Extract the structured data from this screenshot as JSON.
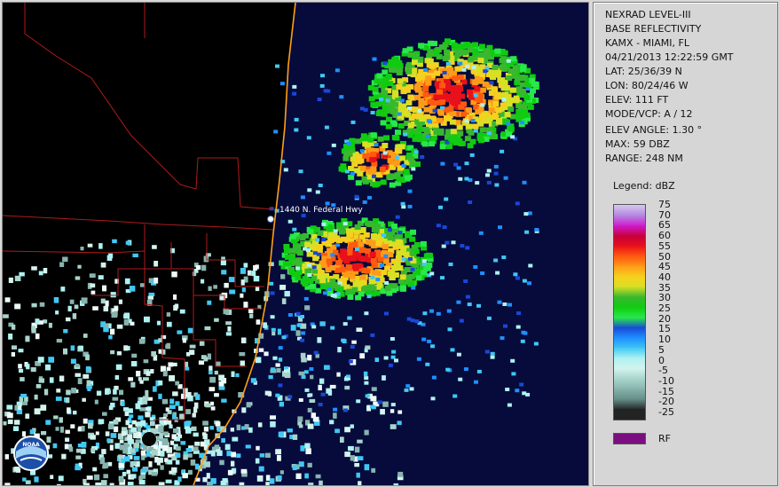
{
  "panel": {
    "product_lines": [
      "NEXRAD LEVEL-III",
      "BASE REFLECTIVITY",
      "KAMX - MIAMI, FL",
      "04/21/2013 12:22:59 GMT",
      "LAT: 25/36/39 N",
      "LON: 80/24/46 W",
      "ELEV: 111 FT",
      "MODE/VCP: A / 12"
    ],
    "scan_lines": [
      "ELEV ANGLE: 1.30 °",
      "MAX: 59 DBZ",
      "RANGE: 248 NM"
    ],
    "legend_title": "Legend: dBZ",
    "legend_levels": [
      {
        "label": "75",
        "color": "#d6c8f0"
      },
      {
        "label": "70",
        "color": "#b486e0"
      },
      {
        "label": "65",
        "color": "#d01ad0"
      },
      {
        "label": "60",
        "color": "#c8003c"
      },
      {
        "label": "55",
        "color": "#e8101a"
      },
      {
        "label": "50",
        "color": "#ff5a10"
      },
      {
        "label": "45",
        "color": "#ff9b18"
      },
      {
        "label": "40",
        "color": "#f6d01e"
      },
      {
        "label": "35",
        "color": "#d8e024"
      },
      {
        "label": "30",
        "color": "#38b82e"
      },
      {
        "label": "25",
        "color": "#10cc10"
      },
      {
        "label": "20",
        "color": "#28e84a"
      },
      {
        "label": "15",
        "color": "#1848d8"
      },
      {
        "label": "10",
        "color": "#1e90ff"
      },
      {
        "label": "5",
        "color": "#40c8f4"
      },
      {
        "label": "0",
        "color": "#aef2f2"
      },
      {
        "label": "-5",
        "color": "#d4f4ee"
      },
      {
        "label": "-10",
        "color": "#a8d4cc"
      },
      {
        "label": "-15",
        "color": "#88b4ae"
      },
      {
        "label": "-20",
        "color": "#668e88"
      },
      {
        "label": "-25",
        "color": "#222424"
      }
    ],
    "rf_label": "RF",
    "rf_color": "#7a1080"
  },
  "map": {
    "marker_label": "1440 N. Federal Hwy",
    "logo_name": "noaa-logo",
    "colors": {
      "ocean": "#060b3c",
      "land": "#000000",
      "county_border": "#b01a1a",
      "coastline": "#ff9d1c"
    }
  }
}
